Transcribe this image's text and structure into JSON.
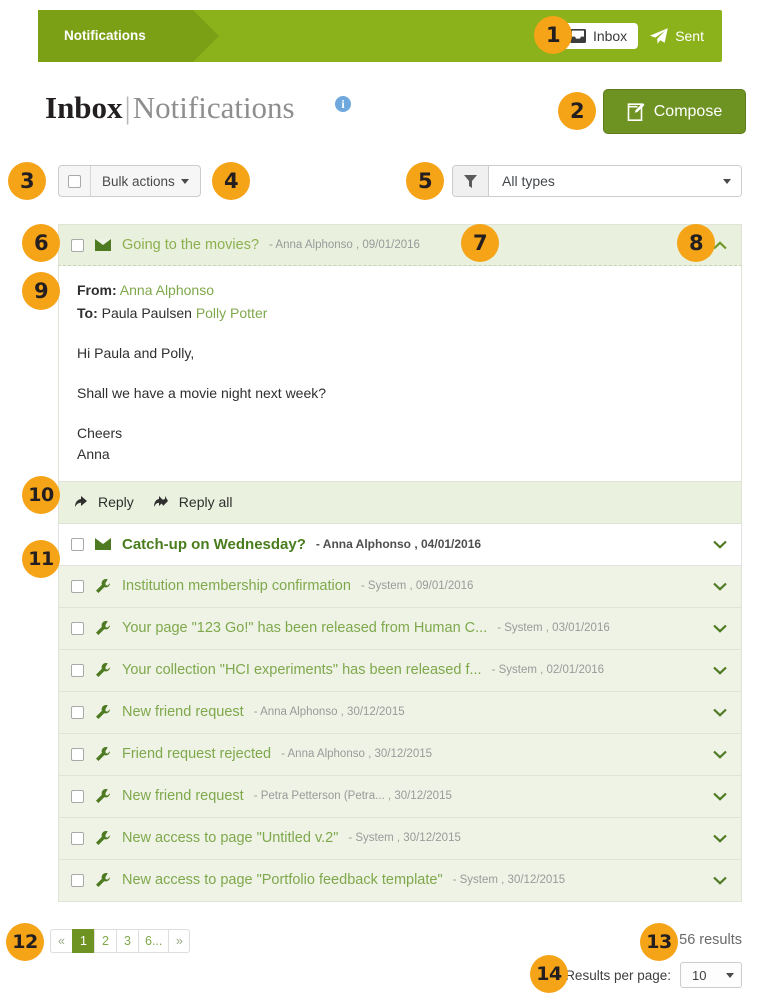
{
  "banner": {
    "tab_label": "Notifications",
    "inbox_label": "Inbox",
    "sent_label": "Sent"
  },
  "header": {
    "title_main": "Inbox",
    "title_sep": "|",
    "title_sub": "Notifications",
    "info_glyph": "i",
    "compose_label": "Compose"
  },
  "toolbar": {
    "bulk_actions_label": "Bulk actions",
    "filter_value": "All types"
  },
  "messages": [
    {
      "title": "Going to the movies?",
      "meta": "- Anna Alphonso , 09/01/2016",
      "icon": "envelope-icon",
      "state": "open",
      "chevron": "chevron-up-icon",
      "detail": {
        "from_label": "From:",
        "from_value": "Anna Alphonso",
        "to_label": "To:",
        "to_value_1": "Paula Paulsen",
        "to_value_2": "Polly Potter",
        "greeting": "Hi Paula and Polly,",
        "body": "Shall we have a movie night next week?",
        "sign_off_1": "Cheers",
        "sign_off_2": "Anna",
        "reply_label": "Reply",
        "reply_all_label": "Reply all"
      }
    },
    {
      "title": "Catch-up on Wednesday?",
      "meta": "- Anna Alphonso , 04/01/2016",
      "icon": "envelope-icon",
      "state": "unread",
      "chevron": "chevron-down-icon"
    },
    {
      "title": "Institution membership confirmation",
      "meta": "- System , 09/01/2016",
      "icon": "wrench-icon",
      "state": "read",
      "chevron": "chevron-down-icon"
    },
    {
      "title": "Your page \"123 Go!\" has been released from Human C...",
      "meta": "- System , 03/01/2016",
      "icon": "wrench-icon",
      "state": "read",
      "chevron": "chevron-down-icon"
    },
    {
      "title": "Your collection \"HCI experiments\" has been released f...",
      "meta": "- System , 02/01/2016",
      "icon": "wrench-icon",
      "state": "read",
      "chevron": "chevron-down-icon"
    },
    {
      "title": "New friend request",
      "meta": "- Anna Alphonso , 30/12/2015",
      "icon": "wrench-icon",
      "state": "read",
      "chevron": "chevron-down-icon"
    },
    {
      "title": "Friend request rejected",
      "meta": "- Anna Alphonso , 30/12/2015",
      "icon": "wrench-icon",
      "state": "read",
      "chevron": "chevron-down-icon"
    },
    {
      "title": "New friend request",
      "meta": "- Petra Petterson (Petra... , 30/12/2015",
      "icon": "wrench-icon",
      "state": "read",
      "chevron": "chevron-down-icon"
    },
    {
      "title": "New access to page \"Untitled v.2\"",
      "meta": "- System , 30/12/2015",
      "icon": "wrench-icon",
      "state": "read",
      "chevron": "chevron-down-icon"
    },
    {
      "title": "New access to page \"Portfolio feedback template\"",
      "meta": "- System , 30/12/2015",
      "icon": "wrench-icon",
      "state": "read",
      "chevron": "chevron-down-icon"
    }
  ],
  "footer": {
    "pagination": [
      "«",
      "1",
      "2",
      "3",
      "6...",
      "»"
    ],
    "active_page": "1",
    "results_text": "56 results",
    "results_per_page_label": "Results per page:",
    "results_per_page_value": "10"
  },
  "callouts": [
    {
      "n": "1"
    },
    {
      "n": "2"
    },
    {
      "n": "3"
    },
    {
      "n": "4"
    },
    {
      "n": "5"
    },
    {
      "n": "6"
    },
    {
      "n": "7"
    },
    {
      "n": "8"
    },
    {
      "n": "9"
    },
    {
      "n": "10"
    },
    {
      "n": "11"
    },
    {
      "n": "12"
    },
    {
      "n": "13"
    },
    {
      "n": "14"
    }
  ],
  "colors": {
    "banner_green": "#8cb21b",
    "banner_tab_green": "#7ba015",
    "button_green": "#6f9322",
    "link_green": "#7fa84c",
    "unread_green": "#4a7d1e",
    "row_bg": "#eef3e5",
    "callout_orange": "#f5a317"
  }
}
